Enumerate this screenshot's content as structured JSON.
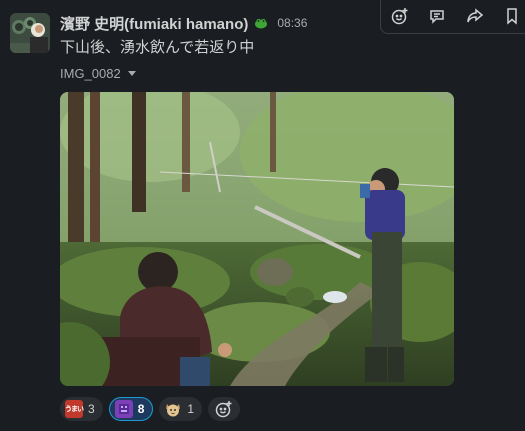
{
  "message": {
    "sender": "濱野 史明(fumiaki hamano)",
    "time": "08:36",
    "text": "下山後、湧水飲んで若返り中",
    "status_icon": "green-frog-icon",
    "attachment": {
      "filename": "IMG_0082",
      "image_description_icon": "photo-forest-spring"
    }
  },
  "actions": [
    "add-reaction-icon",
    "reply-thread-icon",
    "share-icon",
    "bookmark-icon"
  ],
  "reactions": [
    {
      "label": "うまい",
      "count": "3",
      "color": "#c0392b",
      "active": false
    },
    {
      "label": "",
      "count": "8",
      "color": "#7b3fb8",
      "active": true
    },
    {
      "label": "",
      "count": "1",
      "color": "#c9a16b",
      "active": false
    }
  ],
  "colors": {
    "background": "#1a1d21",
    "accent": "#1d9bd1",
    "text": "#d1d2d3"
  }
}
